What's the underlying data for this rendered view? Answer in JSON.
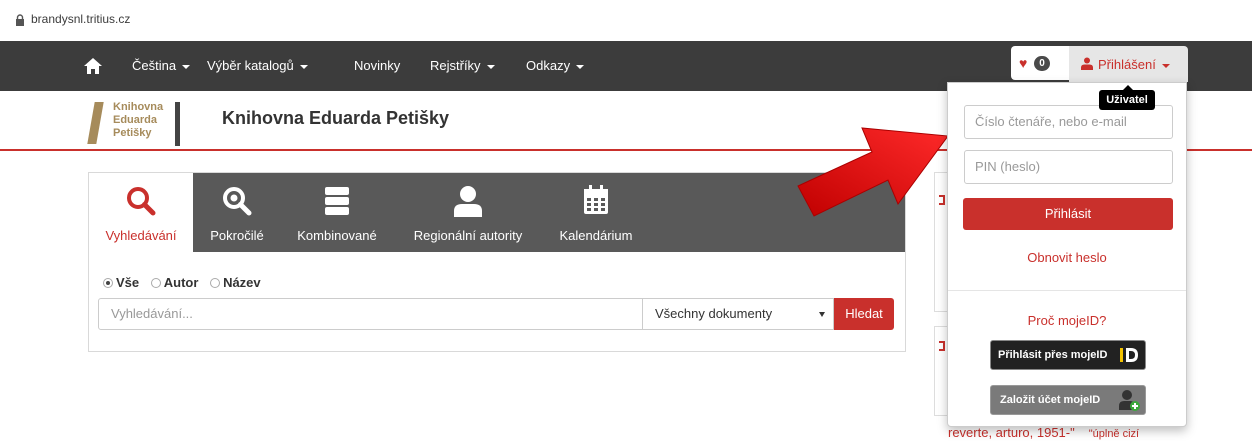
{
  "browser": {
    "url": "brandysnl.tritius.cz"
  },
  "navbar": {
    "items": [
      {
        "label": "Čeština",
        "dropdown": true
      },
      {
        "label": "Výběr katalogů",
        "dropdown": true
      },
      {
        "label": "Novinky",
        "dropdown": false
      },
      {
        "label": "Rejstříky",
        "dropdown": true
      },
      {
        "label": "Odkazy",
        "dropdown": true
      }
    ],
    "favorites_count": "0",
    "login_label": "Přihlášení"
  },
  "header": {
    "logo_lines": [
      "Knihovna",
      "Eduarda",
      "Petišky"
    ],
    "title": "Knihovna Eduarda Petišky"
  },
  "search": {
    "tabs": [
      {
        "label": "Vyhledávání",
        "icon": "search-icon"
      },
      {
        "label": "Pokročilé",
        "icon": "zoom-plus-icon"
      },
      {
        "label": "Kombinované",
        "icon": "server-stack-icon"
      },
      {
        "label": "Regionální autority",
        "icon": "person-icon"
      },
      {
        "label": "Kalendárium",
        "icon": "calendar-icon"
      }
    ],
    "radios": [
      "Vše",
      "Autor",
      "Název"
    ],
    "input_placeholder": "Vyhledávání...",
    "doc_type": "Všechny dokumenty",
    "button": "Hledat"
  },
  "sidebar": {
    "snippet": "reverte, arturo, 1951-\"",
    "snippet_quote": "\"úplně cizí"
  },
  "login_dropdown": {
    "tooltip": "Uživatel",
    "reader_placeholder": "Číslo čtenáře, nebo e-mail",
    "pin_placeholder": "PIN (heslo)",
    "login_button": "Přihlásit",
    "reset_link": "Obnovit heslo",
    "why_mojeid": "Proč mojeID?",
    "mojeid_login": "Přihlásit přes mojeID",
    "mojeid_register": "Založit účet mojeID"
  },
  "colors": {
    "accent": "#c9302c",
    "navbar": "#3c3c3c",
    "tabs": "#595959",
    "logo_gold": "#a68b5b"
  }
}
